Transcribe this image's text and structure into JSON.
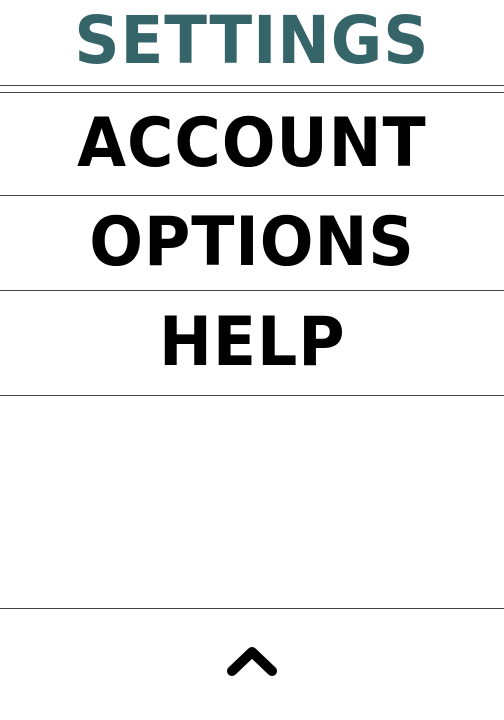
{
  "header": {
    "title": "SETTINGS",
    "title_color": "#366569"
  },
  "menu": {
    "items": [
      {
        "label": "ACCOUNT"
      },
      {
        "label": "OPTIONS"
      },
      {
        "label": "HELP"
      }
    ]
  },
  "footer": {
    "up_icon": "chevron-up-icon"
  }
}
